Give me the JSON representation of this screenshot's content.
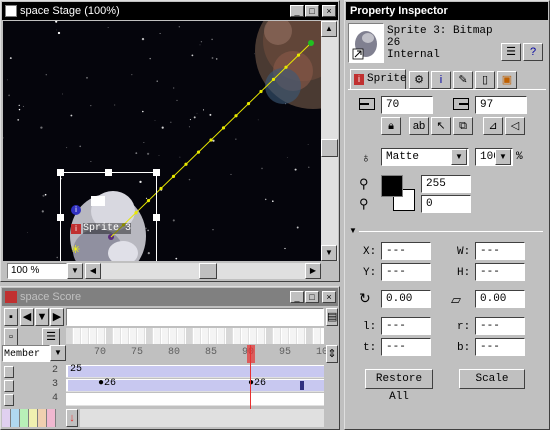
{
  "stage": {
    "title": "space Stage (100%)",
    "zoom": "100 %",
    "sprite_label": "Sprite 3"
  },
  "score": {
    "title": "space Score",
    "member_select": "Member",
    "frame_numbers": [
      "70",
      "75",
      "80",
      "85",
      "90",
      "95",
      "10"
    ],
    "channels": [
      {
        "number": "2",
        "start": "25",
        "end": ""
      },
      {
        "number": "3",
        "start": "26",
        "mid": "26",
        "end": ""
      },
      {
        "number": "4",
        "start": "",
        "end": ""
      }
    ]
  },
  "inspector": {
    "title": "Property Inspector",
    "sprite_name": "Sprite 3: Bitmap",
    "member_number": "26",
    "cast_type": "Internal",
    "tab_sprite": "Sprite",
    "loc_x": "70",
    "loc_y": "97",
    "ink": "Matte",
    "blend": "100",
    "blend_unit": "%",
    "fore_value": "255",
    "back_value": "0",
    "x_label": "X:",
    "y_label": "Y:",
    "w_label": "W:",
    "h_label": "H:",
    "l_label": "l:",
    "t_label": "t:",
    "r_label": "r:",
    "b_label": "b:",
    "x_value": "---",
    "y_value": "---",
    "w_value": "---",
    "h_value": "---",
    "l_value": "---",
    "t_value": "---",
    "r_value": "---",
    "b_value": "---",
    "rotation": "0.00",
    "skew": "0.00",
    "restore_label": "Restore All",
    "scale_label": "Scale"
  },
  "colors": {
    "playhead": "#e83030",
    "span": "#c8c8f0",
    "star_bg": "#0a0a14",
    "path_dot": "#e8e800"
  }
}
